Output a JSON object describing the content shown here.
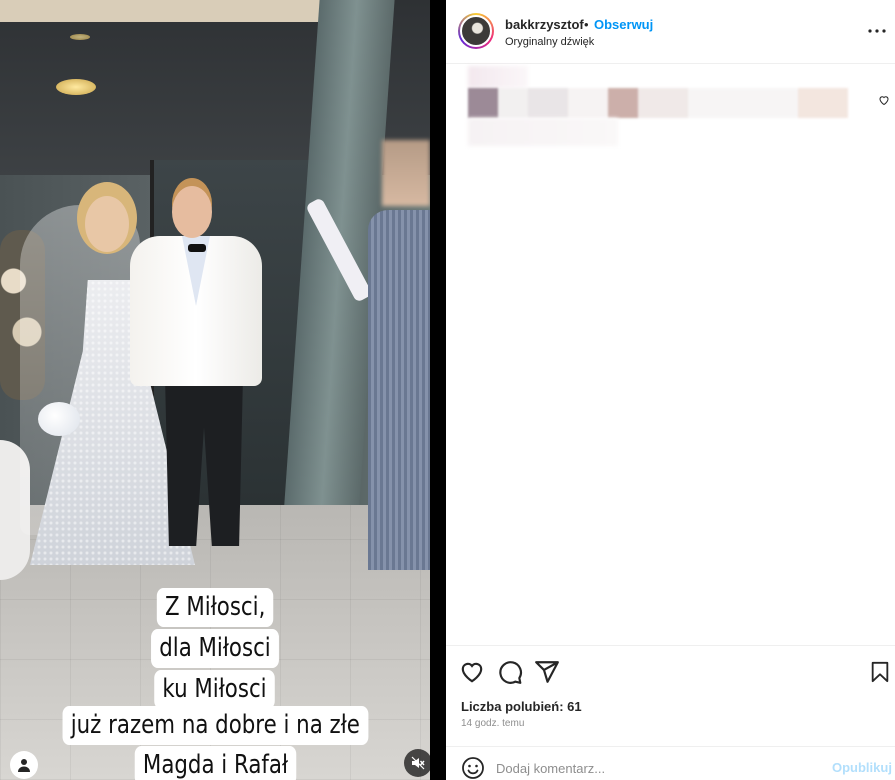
{
  "video": {
    "caption_lines": [
      "Z Miłosci,",
      "dla  Miłosci",
      "ku Miłosci",
      "już razem na dobre i na złe",
      "Magda i Rafał"
    ],
    "avatar_icon": "user-icon",
    "mute_icon": "speaker-muted-icon"
  },
  "post": {
    "username": "bakkrzysztof",
    "separator": "•",
    "follow_label": "Obserwuj",
    "audio_label": "Oryginalny dźwięk",
    "more_icon": "more-horizontal-icon"
  },
  "actions": {
    "icons": [
      "heart-icon",
      "comment-icon",
      "share-icon",
      "bookmark-icon"
    ],
    "likes_text": "Liczba polubień: 61",
    "time_text": "14 godz. temu"
  },
  "comment_box": {
    "placeholder": "Dodaj komentarz...",
    "publish_label": "Opublikuj",
    "emoji_icon": "emoji-icon"
  },
  "colors": {
    "accent": "#0095f6",
    "publish_disabled": "#b2dffc",
    "muted_text": "#8e8e8e"
  }
}
